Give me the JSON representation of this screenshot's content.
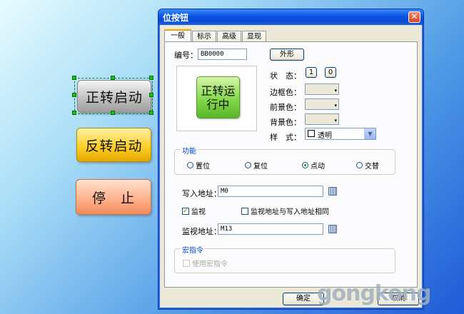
{
  "canvas": {
    "buttons": [
      {
        "label": "正转启动"
      },
      {
        "label": "反转启动"
      },
      {
        "label": "停　止"
      }
    ]
  },
  "dialog": {
    "title": "位按钮",
    "close_glyph": "✕",
    "tabs": [
      "一般",
      "标示",
      "高级",
      "显现"
    ],
    "id_label": "编号：",
    "id_value": "BB0000",
    "shape_button": "外形",
    "preview_text": "正转运行中",
    "state_label": "状　态：",
    "state_values": [
      "1",
      "0"
    ],
    "border_color_label": "边框色：",
    "fg_color_label": "前景色：",
    "bg_color_label": "背景色：",
    "style_label": "样　式：",
    "style_value": "透明",
    "function_group": {
      "title": "功能",
      "options": [
        "置位",
        "复位",
        "点动",
        "交替"
      ],
      "selected": "点动"
    },
    "write_addr_label": "写入地址：",
    "write_addr_value": "M0",
    "monitor_label": "监视",
    "monitor_checked": true,
    "same_addr_label": "监视地址与写入地址相同",
    "same_addr_checked": false,
    "monitor_addr_label": "监视地址：",
    "monitor_addr_value": "M13",
    "macro_group": {
      "title": "宏指令",
      "use_macro_label": "使用宏指令"
    },
    "ok_button": "确定",
    "cancel_button": "取消"
  },
  "watermark": "gongkong",
  "colors": {
    "accent_tab": "#ff9c00",
    "title_blue": "#0b55e5",
    "preview_green": "#84d84c"
  }
}
